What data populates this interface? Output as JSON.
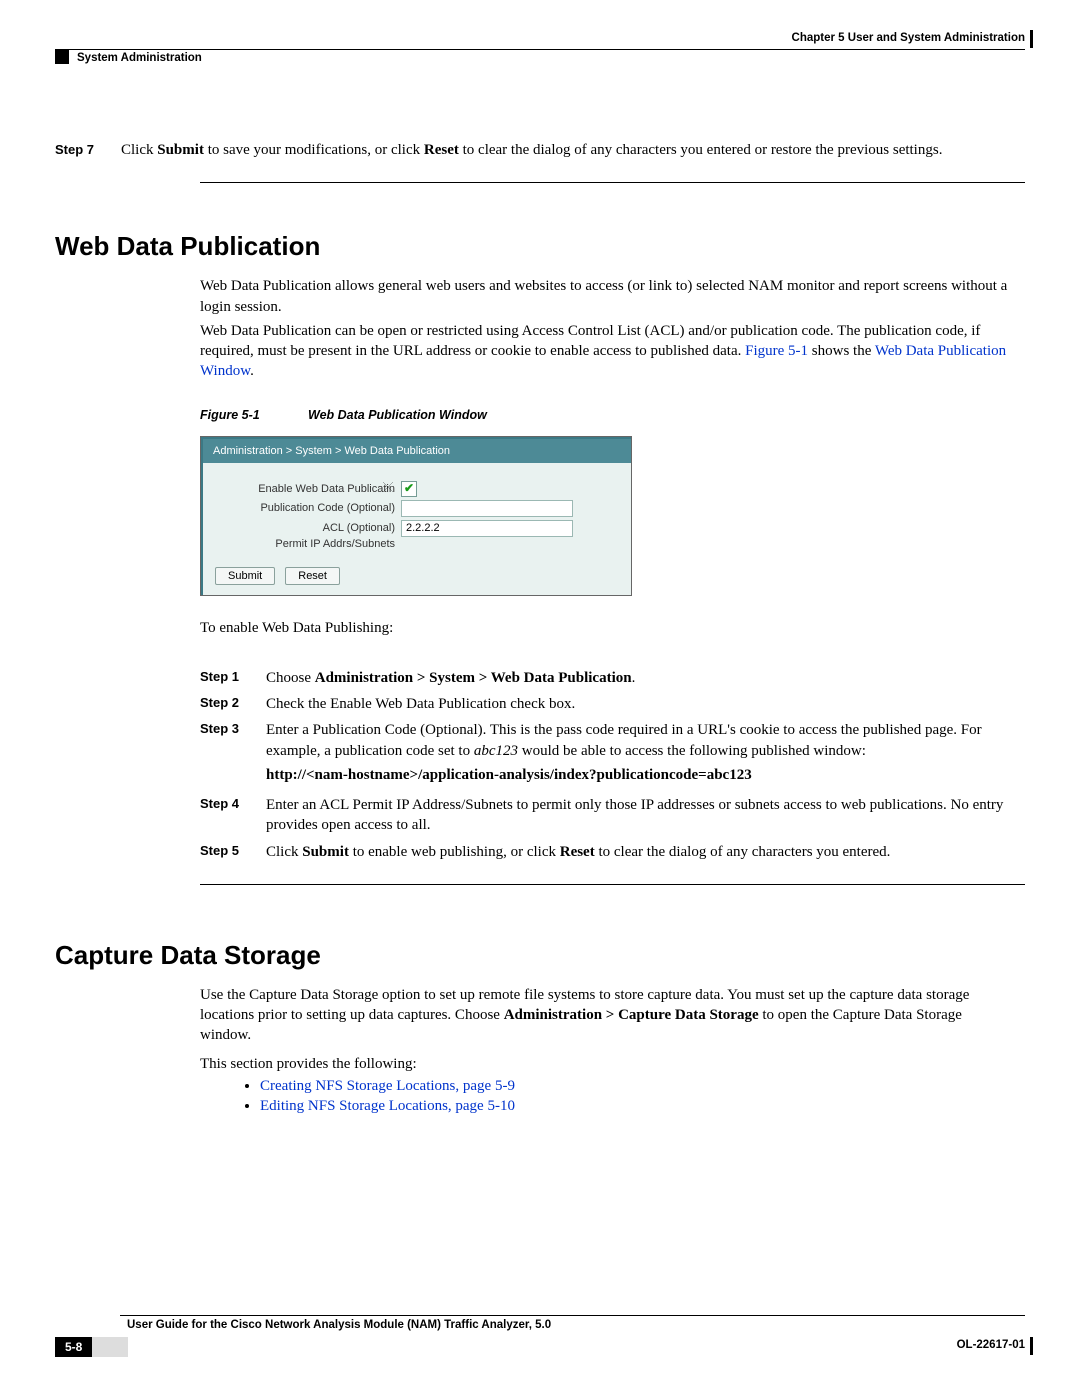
{
  "header": {
    "chapter": "Chapter 5      User and System Administration",
    "section": "System Administration"
  },
  "step7": {
    "label": "Step 7",
    "prefix": "Click ",
    "b1": "Submit",
    "mid": " to save your modifications, or click ",
    "b2": "Reset",
    "suffix": " to clear the dialog of any characters you entered or restore the previous settings."
  },
  "wdp": {
    "heading": "Web Data Publication",
    "p1": "Web Data Publication allows general web users and websites to access (or link to) selected NAM monitor and report screens without a login session.",
    "p2a": "Web Data Publication can be open or restricted using Access Control List (ACL) and/or publication code. The publication code, if required, must be present in the URL address or cookie to enable access to published data. ",
    "p2link1": "Figure 5-1",
    "p2mid": " shows the ",
    "p2link2": "Web Data Publication Window",
    "p2end": ".",
    "fignum": "Figure 5-1",
    "figtitle": "Web Data Publication Window",
    "enable_line": "To enable Web Data Publishing:"
  },
  "shot": {
    "breadcrumb": "Administration > System > Web Data Publication",
    "l1": "Enable Web Data Publicati",
    "l1b": "n",
    "l2": "Publication Code (Optional)",
    "l3": "ACL (Optional)",
    "l4": "Permit IP Addrs/Subnets",
    "ip": "2.2.2.2",
    "submit": "Submit",
    "reset": "Reset"
  },
  "steps": [
    {
      "label": "Step 1",
      "pre": "Choose ",
      "bold": "Administration > System > Web Data Publication",
      "post": "."
    },
    {
      "label": "Step 2",
      "text": "Check the Enable Web Data Publication check box."
    },
    {
      "label": "Step 3",
      "t1": "Enter a Publication Code (Optional). This is the pass code required in a URL's cookie to access the published page. For example, a publication code set to ",
      "ital": "abc123",
      "t2": " would be able to access the following published window:",
      "url": "http://<nam-hostname>/application-analysis/index?publicationcode=abc123"
    },
    {
      "label": "Step 4",
      "text": "Enter an ACL Permit IP Address/Subnets to permit only those IP addresses or subnets access to web publications. No entry provides open access to all."
    },
    {
      "label": "Step 5",
      "pre": "Click ",
      "b1": "Submit",
      "mid": " to enable web publishing, or click ",
      "b2": "Reset",
      "post": " to clear the dialog of any characters you entered."
    }
  ],
  "cds": {
    "heading": "Capture Data Storage",
    "p1a": "Use the Capture Data Storage option to set up remote file systems to store capture data. You must set up the capture data storage locations prior to setting up data captures. Choose ",
    "p1b": "Administration > Capture Data Storage",
    "p1c": " to open the Capture Data Storage window.",
    "p2": "This section provides the following:",
    "b1": "Creating NFS Storage Locations, page 5-9",
    "b2": "Editing NFS Storage Locations, page 5-10"
  },
  "footer": {
    "title": "User Guide for the Cisco Network Analysis Module (NAM) Traffic Analyzer, 5.0",
    "page": "5-8",
    "ol": "OL-22617-01"
  }
}
